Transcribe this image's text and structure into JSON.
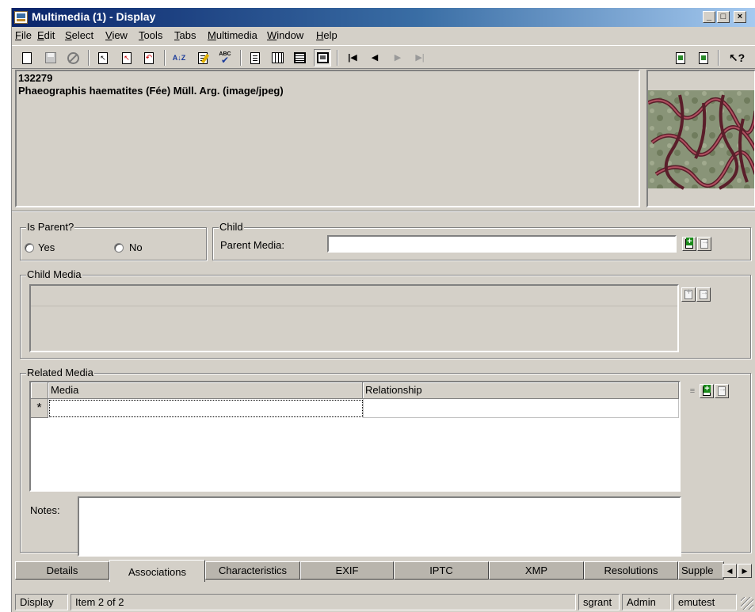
{
  "window": {
    "title": "Multimedia (1) - Display",
    "caption_buttons": [
      "_",
      "□",
      "×"
    ]
  },
  "menu": [
    "File",
    "Edit",
    "Select",
    "View",
    "Tools",
    "Tabs",
    "Multimedia",
    "Window",
    "Help"
  ],
  "toolbar": {
    "icons": [
      "new-document-icon",
      "save-icon",
      "cancel-icon",
      "select-icon",
      "unselect-icon",
      "undo-select-icon",
      "sort-icon",
      "edit-icon",
      "spellcheck-icon",
      "page-view-icon",
      "grid-view-icon",
      "list-view-icon",
      "image-view-icon",
      "first-record-icon",
      "previous-record-icon",
      "next-record-icon",
      "last-record-icon",
      "copy-record-icon",
      "paste-record-icon",
      "context-help-icon"
    ],
    "sort_glyph": "A↓Z",
    "spell_glyph": "ABC"
  },
  "record": {
    "irn": "132279",
    "summary": "Phaeographis haematites (Fée) Müll. Arg. (image/jpeg)"
  },
  "is_parent": {
    "label": "Is Parent?",
    "yes": "Yes",
    "no": "No"
  },
  "child": {
    "label": "Child",
    "parent_media_label": "Parent Media:",
    "parent_media_value": ""
  },
  "child_media": {
    "label": "Child Media"
  },
  "related_media": {
    "label": "Related Media",
    "columns": [
      "Media",
      "Relationship"
    ],
    "new_row_marker": "*",
    "notes_label": "Notes:",
    "notes_value": ""
  },
  "tabs": [
    {
      "label": "Details",
      "active": false
    },
    {
      "label": "Associations",
      "active": true
    },
    {
      "label": "Characteristics",
      "active": false
    },
    {
      "label": "EXIF",
      "active": false
    },
    {
      "label": "IPTC",
      "active": false
    },
    {
      "label": "XMP",
      "active": false
    },
    {
      "label": "Resolutions",
      "active": false
    },
    {
      "label": "Supple",
      "active": false
    }
  ],
  "status": {
    "mode": "Display",
    "item": "Item 2 of 2",
    "user": "sgrant",
    "group": "Admin",
    "database": "emutest"
  },
  "colors": {
    "titlebar_start": "#0a246a",
    "titlebar_end": "#a6caf0",
    "face": "#d4d0c8",
    "add_green": "#1a8a1a"
  }
}
